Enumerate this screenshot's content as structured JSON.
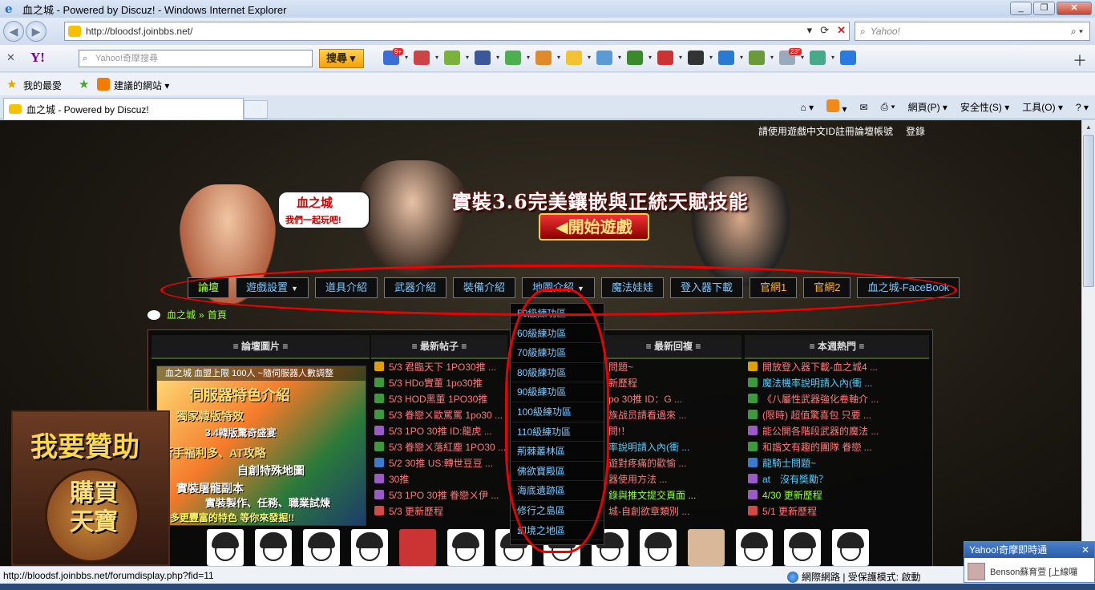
{
  "window": {
    "title": "血之城 - Powered by Discuz! - Windows Internet Explorer"
  },
  "address": {
    "url": "http://bloodsf.joinbbs.net/",
    "search_placeholder": "Yahoo!"
  },
  "yahoo_toolbar": {
    "logo": "Y!",
    "search_placeholder": "Yahoo!奇摩搜尋",
    "search_button": "搜尋",
    "mail_badge": "9+",
    "weather_badge": "23°"
  },
  "favorites_bar": {
    "favorites_label": "我的最愛",
    "suggested_label": "建議的網站"
  },
  "tab": {
    "title": "血之城 - Powered by Discuz!"
  },
  "command_bar": {
    "page": "網頁(P)",
    "safety": "安全性(S)",
    "tools": "工具(O)"
  },
  "site": {
    "top_links": [
      "請使用遊戲中文ID註冊論壇帳號",
      "登錄"
    ],
    "banner": {
      "logo_text": "血之城",
      "bubble_text": "我們一起玩吧!",
      "slogan": "實裝3.6完美鑲嵌與正統天賦技能",
      "start_button": "開始遊戲"
    },
    "nav": [
      "論壇",
      "遊戲設置",
      "道具介紹",
      "武器介紹",
      "裝備介紹",
      "地圖介紹",
      "魔法娃娃",
      "登入器下載",
      "官網1",
      "官網2",
      "血之城-FaceBook"
    ],
    "map_dropdown": [
      "50級練功區",
      "60級練功區",
      "70級練功區",
      "80級練功區",
      "90級練功區",
      "100級練功區",
      "110級練功區",
      "荊棘叢林區",
      "佛欲寶殿區",
      "海底遺跡區",
      "修行之島區",
      "幻境之地區"
    ],
    "breadcrumb": {
      "home": "血之城",
      "sep": "»",
      "current": "首頁"
    },
    "columns": {
      "pictures": "≡ 論壇圖片 ≡",
      "new_posts": "≡ 最新帖子 ≡",
      "new_replies": "≡ 最新回複 ≡",
      "hot": "≡ 本週熱門 ≡"
    },
    "picture_caption": "血之城 血盟上限 100人 ~隨伺服器人數調整",
    "picture_lines": [
      "伺服器特色介紹",
      "獨家韓版特效",
      "3.4韓版驚奇盛宴",
      "新手福利多、AT攻略",
      "自創特殊地圖",
      "實裝屠龍副本",
      "實裝製作、任務、職業試煉",
      "多更豐富的特色 等你來發掘!!"
    ],
    "new_posts": [
      "5/3 君臨天下 1PO30推 ...",
      "5/3 HDo實董 1po30推",
      "5/3 HOD黑董 1PO30推",
      "5/3 眷戀ㄨ歐罵罵 1po30 ...",
      "5/3 1PO 30推 ID:龍虎 ...",
      "5/3 眷戀ㄨ落紅塵 1PO30 ...",
      "5/2 30推 US:轉世豆豆 ...",
      "30推",
      "5/3 1PO 30推 眷戀ㄨ伊 ...",
      "5/3 更新歷程"
    ],
    "new_replies": [
      "問題~",
      "新歷程",
      "po 30推 ID：G ...",
      "族战员請看過來 ...",
      "問!！",
      "率說明請入內(衝 ...",
      "遊對疼痛的歡愉 ...",
      "器使用方法 ...",
      "錄與推文提交頁面 ...",
      "城-自創欲章類別 ..."
    ],
    "hot": [
      "開放登入器下載-血之城4 ...",
      "魔法機率說明請入內(衝 ...",
      "《八屬性武器強化卷軸介 ...",
      "(限時) 超值驚喜包 只要 ...",
      "能公開各階段武器的魔法 ...",
      "和諧文有趣的團隊 眷戀 ...",
      "龍騎士問題~",
      "at　沒有獎勵？",
      "4/30 更新歷程",
      "5/1 更新歷程"
    ],
    "sponsor": {
      "line1": "我要贊助",
      "line2": "購買天寶"
    }
  },
  "status_bar": {
    "url": "http://bloodsf.joinbbs.net/forumdisplay.php?fid=11",
    "zone": "網際網路 | 受保護模式: 啟動"
  },
  "notification": {
    "title": "Yahoo!奇摩即時通",
    "text": "Benson蘇育萱 [上線囉"
  },
  "colors": {
    "accent_red": "#e00000",
    "link_blue": "#7ec8ff",
    "green": "#8fff3a"
  }
}
